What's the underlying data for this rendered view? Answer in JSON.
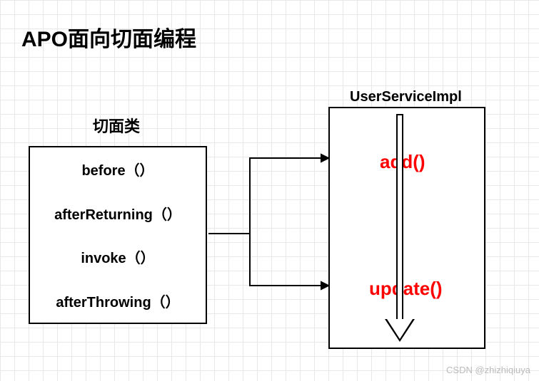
{
  "title": "APO面向切面编程",
  "aspect": {
    "label": "切面类",
    "methods": [
      "before（）",
      "afterReturning（）",
      "invoke（）",
      "afterThrowing（）"
    ]
  },
  "service": {
    "label": "UserServiceImpl",
    "methods": {
      "add": "add()",
      "update": "update()"
    }
  },
  "watermark": "CSDN @zhizhiqiuya"
}
